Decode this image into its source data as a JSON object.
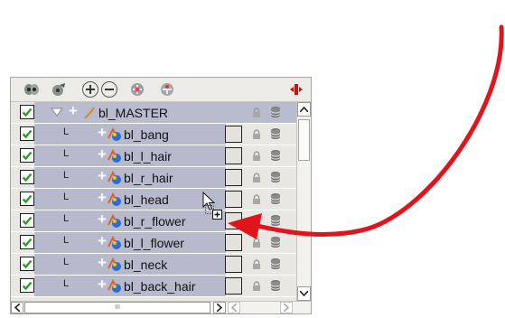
{
  "toolbar": {
    "icons": [
      "animation-mode-icon",
      "camera-icon",
      "add-layer-icon",
      "remove-layer-icon",
      "add-group-icon",
      "peg-icon",
      "collapse-icon"
    ]
  },
  "layers": [
    {
      "name": "bl_MASTER",
      "visible": true,
      "selected": true,
      "type": "master"
    },
    {
      "name": "bl_bang",
      "visible": true,
      "selected": false,
      "type": "drawing"
    },
    {
      "name": "bl_l_hair",
      "visible": true,
      "selected": false,
      "type": "drawing"
    },
    {
      "name": "bl_r_hair",
      "visible": true,
      "selected": false,
      "type": "drawing"
    },
    {
      "name": "bl_head",
      "visible": true,
      "selected": false,
      "type": "drawing"
    },
    {
      "name": "bl_r_flower",
      "visible": true,
      "selected": false,
      "type": "drawing"
    },
    {
      "name": "bl_l_flower",
      "visible": true,
      "selected": false,
      "type": "drawing"
    },
    {
      "name": "bl_neck",
      "visible": true,
      "selected": false,
      "type": "drawing"
    },
    {
      "name": "bl_back_hair",
      "visible": true,
      "selected": false,
      "type": "drawing"
    }
  ],
  "tree": {
    "child_marker": "L",
    "add_marker": "+"
  },
  "scroll": {
    "h_thumb_grip": "III"
  },
  "colors": {
    "check": "#2e9b24",
    "arrow": "#e0141a",
    "row_bg": "#b7b9cc"
  }
}
